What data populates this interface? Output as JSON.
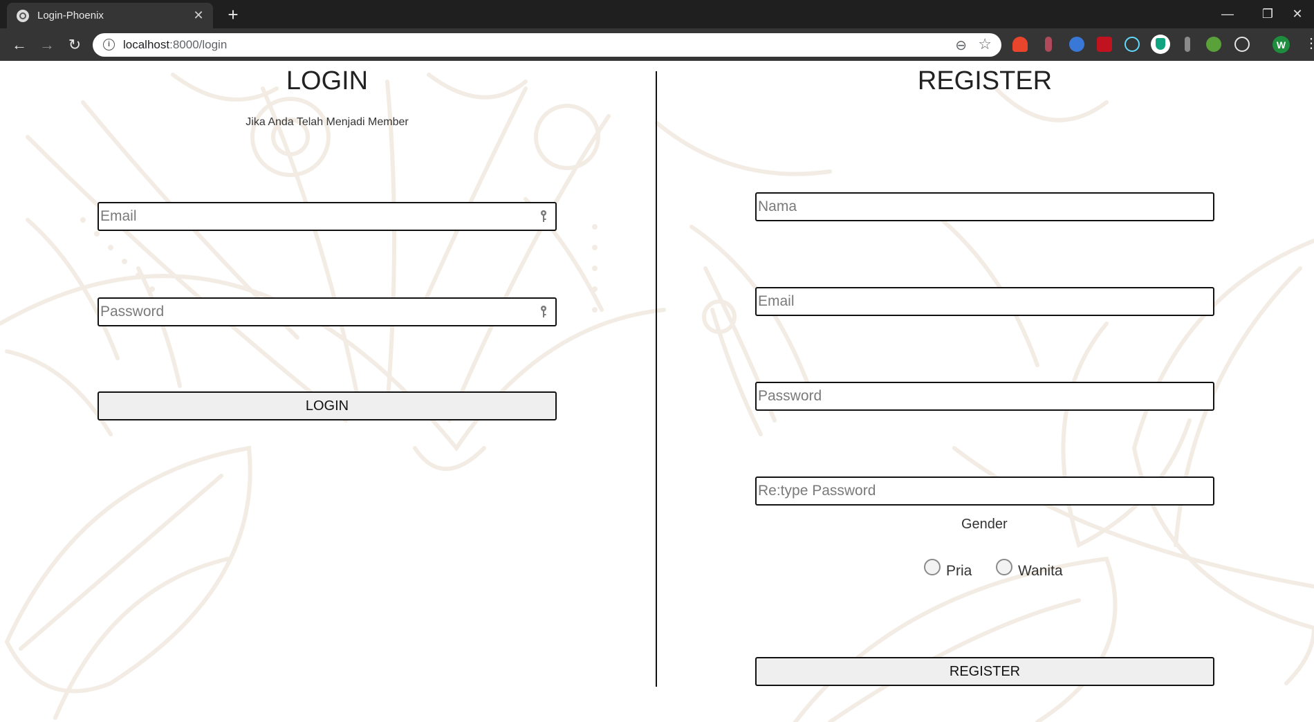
{
  "browser": {
    "tab_title": "Login-Phoenix",
    "tab_close": "✕",
    "new_tab": "+",
    "url_host": "localhost",
    "url_path": ":8000/login",
    "profile_initial": "W",
    "window_controls": {
      "minimize": "—",
      "restore": "❐",
      "close": "✕"
    },
    "nav": {
      "back": "←",
      "forward": "→",
      "reload": "↻"
    },
    "icons": {
      "zoom": "⊖",
      "star": "☆",
      "kebab": "⋮",
      "info": "i"
    }
  },
  "login": {
    "title": "LOGIN",
    "subtitle": "Jika Anda Telah Menjadi Member",
    "email_placeholder": "Email",
    "password_placeholder": "Password",
    "button_label": "LOGIN"
  },
  "register": {
    "title": "REGISTER",
    "name_placeholder": "Nama",
    "email_placeholder": "Email",
    "password_placeholder": "Password",
    "retype_placeholder": "Re:type Password",
    "gender_label": "Gender",
    "gender_options": [
      "Pria",
      "Wanita"
    ],
    "button_label": "REGISTER"
  },
  "colors": {
    "ornament": "#f2ece4",
    "border": "#111111",
    "button_bg": "#efefef",
    "chrome_dark": "#1f1f1f",
    "chrome_toolbar": "#353535"
  }
}
